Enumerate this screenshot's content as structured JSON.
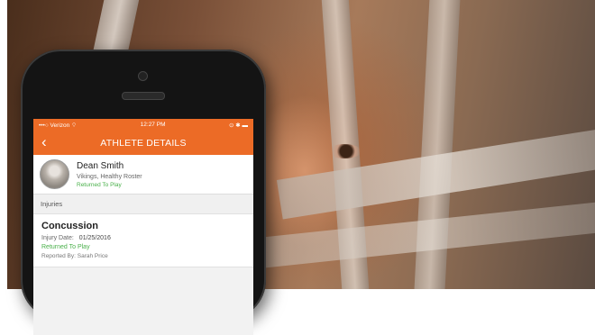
{
  "status_bar": {
    "carrier": "•••○ Verizon ⌔",
    "time": "12:27 PM",
    "right": "⊙ ✱ ▬"
  },
  "nav": {
    "title": "ATHLETE DETAILS",
    "back_glyph": "‹"
  },
  "athlete": {
    "name": "Dean Smith",
    "team": "Vikings, Healthy Roster",
    "status": "Returned To Play"
  },
  "section": {
    "label": "Injuries"
  },
  "injury": {
    "title": "Concussion",
    "date_label": "Injury Date:",
    "date_value": "01/25/2016",
    "status": "Returned To Play",
    "reported_by": "Reported By: Sarah Price"
  },
  "colors": {
    "accent": "#ec6b26",
    "status_green": "#49b04a"
  }
}
